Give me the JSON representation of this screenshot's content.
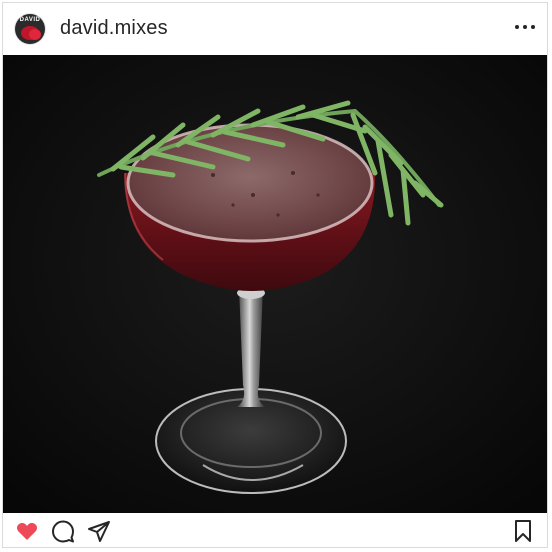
{
  "post": {
    "username": "david.mixes",
    "avatar": {
      "label": "DAVID",
      "icon": "avatar-icon"
    },
    "image": {
      "description_icon": "cocktail-photo"
    },
    "actions": {
      "like_icon": "heart-filled-icon",
      "comment_icon": "comment-icon",
      "share_icon": "share-icon",
      "save_icon": "bookmark-icon",
      "liked": true
    },
    "colors": {
      "like": "#ed4956",
      "text": "#262626",
      "border": "#dbdbdb"
    }
  }
}
